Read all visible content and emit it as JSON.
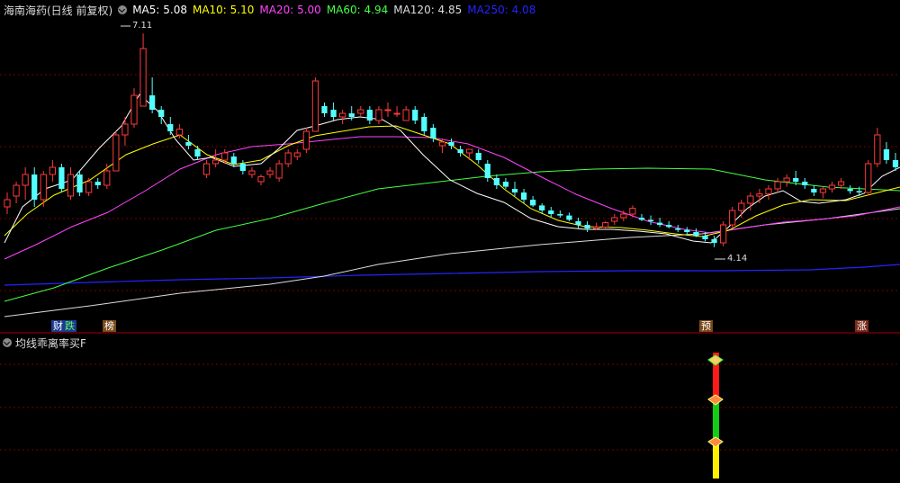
{
  "header": {
    "title": "海南海药(日线 前复权)",
    "ma": [
      {
        "label": "MA5: 5.08",
        "color": "#ffffff"
      },
      {
        "label": "MA10: 5.10",
        "color": "#ffff00"
      },
      {
        "label": "MA20: 5.00",
        "color": "#ff44ff"
      },
      {
        "label": "MA60: 4.94",
        "color": "#44ff44"
      },
      {
        "label": "MA120: 4.85",
        "color": "#dcdcdc"
      },
      {
        "label": "MA250: 4.08",
        "color": "#2424ff"
      }
    ]
  },
  "indicator": {
    "title": "均线乖离率买F"
  },
  "tags": {
    "cai": "财",
    "die": "跌",
    "bang": "榜",
    "yu": "预",
    "zhang": "涨"
  },
  "annotations": {
    "high": "7.11",
    "low": "4.14"
  },
  "chart_data": {
    "type": "candlestick",
    "ylim": [
      3.2,
      7.3
    ],
    "ohlc": [
      [
        4.7,
        4.9,
        4.6,
        4.8
      ],
      [
        4.85,
        5.05,
        4.75,
        5.0
      ],
      [
        5.0,
        5.25,
        4.8,
        5.15
      ],
      [
        5.15,
        5.25,
        4.7,
        4.8
      ],
      [
        4.8,
        5.2,
        4.7,
        5.15
      ],
      [
        5.15,
        5.35,
        5.05,
        5.25
      ],
      [
        5.25,
        5.3,
        4.9,
        4.95
      ],
      [
        4.85,
        5.25,
        4.8,
        5.15
      ],
      [
        5.15,
        5.2,
        4.85,
        4.9
      ],
      [
        4.9,
        5.1,
        4.85,
        5.05
      ],
      [
        5.05,
        5.1,
        4.95,
        5.0
      ],
      [
        5.0,
        5.3,
        4.95,
        5.2
      ],
      [
        5.2,
        5.75,
        5.2,
        5.7
      ],
      [
        5.7,
        5.95,
        5.55,
        5.85
      ],
      [
        5.85,
        6.35,
        5.8,
        6.25
      ],
      [
        6.1,
        7.11,
        6.1,
        6.9
      ],
      [
        6.25,
        6.5,
        6.0,
        6.05
      ],
      [
        6.05,
        6.1,
        5.85,
        5.95
      ],
      [
        5.85,
        5.95,
        5.7,
        5.75
      ],
      [
        5.7,
        5.85,
        5.65,
        5.78
      ],
      [
        5.6,
        5.7,
        5.5,
        5.55
      ],
      [
        5.5,
        5.55,
        5.35,
        5.4
      ],
      [
        5.15,
        5.35,
        5.1,
        5.3
      ],
      [
        5.3,
        5.5,
        5.25,
        5.35
      ],
      [
        5.35,
        5.5,
        5.3,
        5.45
      ],
      [
        5.4,
        5.45,
        5.25,
        5.3
      ],
      [
        5.3,
        5.35,
        5.15,
        5.2
      ],
      [
        5.15,
        5.25,
        5.1,
        5.2
      ],
      [
        5.05,
        5.15,
        5.0,
        5.12
      ],
      [
        5.15,
        5.25,
        5.1,
        5.2
      ],
      [
        5.1,
        5.35,
        5.05,
        5.3
      ],
      [
        5.3,
        5.5,
        5.25,
        5.45
      ],
      [
        5.4,
        5.5,
        5.35,
        5.45
      ],
      [
        5.5,
        5.8,
        5.45,
        5.75
      ],
      [
        5.75,
        6.5,
        5.75,
        6.45
      ],
      [
        6.1,
        6.15,
        5.95,
        6.0
      ],
      [
        6.05,
        6.15,
        5.9,
        5.95
      ],
      [
        5.95,
        6.05,
        5.85,
        6.0
      ],
      [
        6.0,
        6.1,
        5.9,
        5.95
      ],
      [
        6.0,
        6.1,
        5.95,
        6.05
      ],
      [
        6.05,
        6.1,
        5.85,
        5.9
      ],
      [
        5.9,
        6.1,
        5.85,
        6.05
      ],
      [
        6.05,
        6.15,
        5.95,
        6.05
      ],
      [
        6.0,
        6.1,
        5.95,
        6.0
      ],
      [
        5.9,
        6.1,
        5.9,
        6.05
      ],
      [
        6.05,
        6.1,
        5.85,
        5.9
      ],
      [
        5.95,
        6.0,
        5.7,
        5.75
      ],
      [
        5.8,
        5.85,
        5.6,
        5.65
      ],
      [
        5.55,
        5.65,
        5.45,
        5.6
      ],
      [
        5.6,
        5.65,
        5.5,
        5.55
      ],
      [
        5.5,
        5.55,
        5.4,
        5.45
      ],
      [
        5.45,
        5.5,
        5.35,
        5.5
      ],
      [
        5.45,
        5.5,
        5.3,
        5.35
      ],
      [
        5.3,
        5.35,
        5.05,
        5.1
      ],
      [
        5.1,
        5.15,
        4.95,
        5.0
      ],
      [
        5.05,
        5.1,
        4.95,
        4.98
      ],
      [
        4.95,
        5.05,
        4.85,
        4.9
      ],
      [
        4.9,
        4.95,
        4.75,
        4.8
      ],
      [
        4.8,
        4.85,
        4.7,
        4.72
      ],
      [
        4.72,
        4.75,
        4.6,
        4.65
      ],
      [
        4.65,
        4.7,
        4.55,
        4.6
      ],
      [
        4.6,
        4.65,
        4.55,
        4.58
      ],
      [
        4.58,
        4.62,
        4.5,
        4.52
      ],
      [
        4.5,
        4.55,
        4.4,
        4.45
      ],
      [
        4.45,
        4.5,
        4.35,
        4.4
      ],
      [
        4.4,
        4.48,
        4.38,
        4.42
      ],
      [
        4.42,
        4.5,
        4.4,
        4.48
      ],
      [
        4.5,
        4.6,
        4.45,
        4.55
      ],
      [
        4.55,
        4.65,
        4.5,
        4.6
      ],
      [
        4.6,
        4.72,
        4.55,
        4.68
      ],
      [
        4.55,
        4.6,
        4.5,
        4.52
      ],
      [
        4.52,
        4.58,
        4.45,
        4.5
      ],
      [
        4.48,
        4.55,
        4.42,
        4.45
      ],
      [
        4.45,
        4.5,
        4.4,
        4.42
      ],
      [
        4.4,
        4.45,
        4.35,
        4.38
      ],
      [
        4.38,
        4.42,
        4.3,
        4.35
      ],
      [
        4.35,
        4.4,
        4.28,
        4.3
      ],
      [
        4.3,
        4.35,
        4.22,
        4.25
      ],
      [
        4.25,
        4.3,
        4.14,
        4.2
      ],
      [
        4.2,
        4.5,
        4.15,
        4.45
      ],
      [
        4.45,
        4.7,
        4.4,
        4.65
      ],
      [
        4.65,
        4.8,
        4.55,
        4.75
      ],
      [
        4.75,
        4.9,
        4.65,
        4.85
      ],
      [
        4.85,
        4.95,
        4.75,
        4.88
      ],
      [
        4.88,
        5.0,
        4.8,
        4.95
      ],
      [
        4.95,
        5.1,
        4.9,
        5.05
      ],
      [
        5.05,
        5.15,
        4.98,
        5.1
      ],
      [
        5.1,
        5.2,
        5.0,
        5.05
      ],
      [
        5.05,
        5.1,
        4.95,
        5.0
      ],
      [
        4.95,
        5.0,
        4.85,
        4.9
      ],
      [
        4.9,
        4.98,
        4.82,
        4.95
      ],
      [
        4.95,
        5.05,
        4.9,
        5.0
      ],
      [
        5.0,
        5.1,
        4.95,
        5.05
      ],
      [
        4.95,
        5.0,
        4.88,
        4.92
      ],
      [
        4.92,
        4.98,
        4.85,
        4.9
      ],
      [
        4.9,
        5.35,
        4.88,
        5.3
      ],
      [
        5.3,
        5.8,
        5.25,
        5.7
      ],
      [
        5.5,
        5.6,
        5.3,
        5.35
      ],
      [
        5.35,
        5.45,
        5.2,
        5.25
      ]
    ]
  }
}
